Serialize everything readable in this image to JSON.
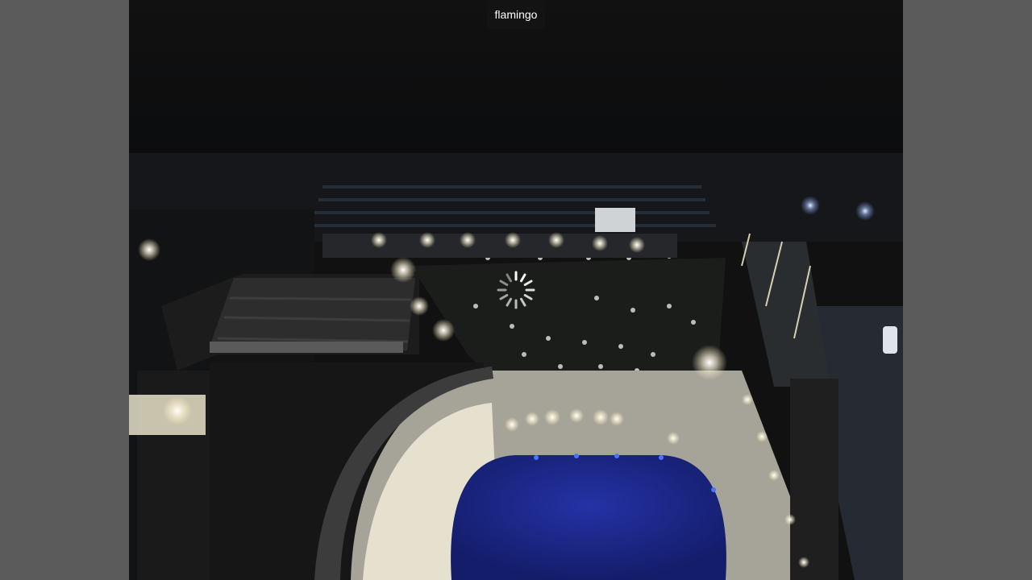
{
  "viewer": {
    "title": "flamingo"
  },
  "webcam_image": {
    "icon": "webcam-night-aerial-hotel-pool"
  },
  "loading": {
    "icon": "loading-spinner-icon",
    "color": "#ffffff"
  },
  "colors": {
    "side_background": "#5b5b5b",
    "frame_background": "#111111",
    "badge_background": "#141414",
    "pool": "#1d2a8a"
  }
}
